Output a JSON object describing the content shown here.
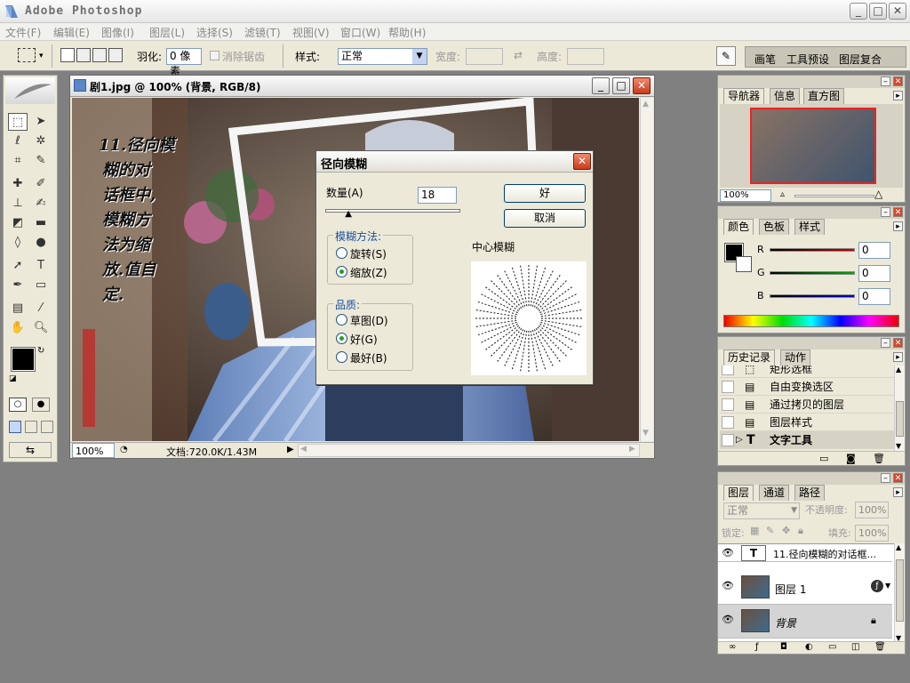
{
  "app": {
    "title": "Adobe Photoshop"
  },
  "window_controls": {
    "minimize": "_",
    "maximize": "□",
    "close": "✕"
  },
  "menubar": {
    "items": [
      "文件(F)",
      "编辑(E)",
      "图像(I)",
      "图层(L)",
      "选择(S)",
      "滤镜(T)",
      "视图(V)",
      "窗口(W)",
      "帮助(H)"
    ]
  },
  "options_bar": {
    "feather_label": "羽化:",
    "feather_value": "0 像素",
    "antialias_label": "消除锯齿",
    "style_label": "样式:",
    "style_value": "正常",
    "width_label": "宽度:",
    "height_label": "高度:",
    "palette_tabs": [
      "画笔",
      "工具预设",
      "图层复合"
    ]
  },
  "document": {
    "title": "剧1.jpg @ 100% (背景, RGB/8)",
    "zoom": "100%",
    "doc_info": "文档:720.0K/1.43M",
    "overlay_text": [
      "11.径向模",
      "糊的对",
      "话框中,",
      "模糊方",
      "法为缩",
      "放.值自",
      "定."
    ]
  },
  "dialog": {
    "title": "径向模糊",
    "amount_label": "数量(A)",
    "amount_value": "18",
    "amount_level": 18,
    "ok_label": "好",
    "cancel_label": "取消",
    "method_label": "模糊方法:",
    "method_options": [
      "旋转(S)",
      "缩放(Z)"
    ],
    "method_selected": 1,
    "quality_label": "品质:",
    "quality_options": [
      "草图(D)",
      "好(G)",
      "最好(B)"
    ],
    "quality_selected": 1,
    "center_label": "中心模糊"
  },
  "navigator": {
    "tabs": [
      "导航器",
      "信息",
      "直方图"
    ],
    "zoom": "100%"
  },
  "color_panel": {
    "tabs": [
      "颜色",
      "色板",
      "样式"
    ],
    "channels": [
      {
        "label": "R",
        "value": "0",
        "color": "#cc0000"
      },
      {
        "label": "G",
        "value": "0",
        "color": "#00aa00"
      },
      {
        "label": "B",
        "value": "0",
        "color": "#0000cc"
      }
    ]
  },
  "history_panel": {
    "tabs": [
      "历史记录",
      "动作"
    ],
    "items": [
      "矩形选框",
      "自由变换选区",
      "通过拷贝的图层",
      "图层样式",
      "文字工具"
    ],
    "selected": 4
  },
  "layers_panel": {
    "tabs": [
      "图层",
      "通道",
      "路径"
    ],
    "blend_mode": "正常",
    "opacity_label": "不透明度:",
    "opacity_value": "100%",
    "lock_label": "锁定:",
    "fill_label": "填充:",
    "fill_value": "100%",
    "layers": [
      {
        "name": "11.径向模糊的对话框...",
        "kind": "text"
      },
      {
        "name": "图层 1",
        "kind": "image"
      },
      {
        "name": "背景",
        "kind": "background"
      }
    ],
    "selected": 2
  },
  "colors": {
    "accent": "#316ac5",
    "dialog_close": "#d03b23",
    "photo_blue": "#6f8fc0"
  }
}
